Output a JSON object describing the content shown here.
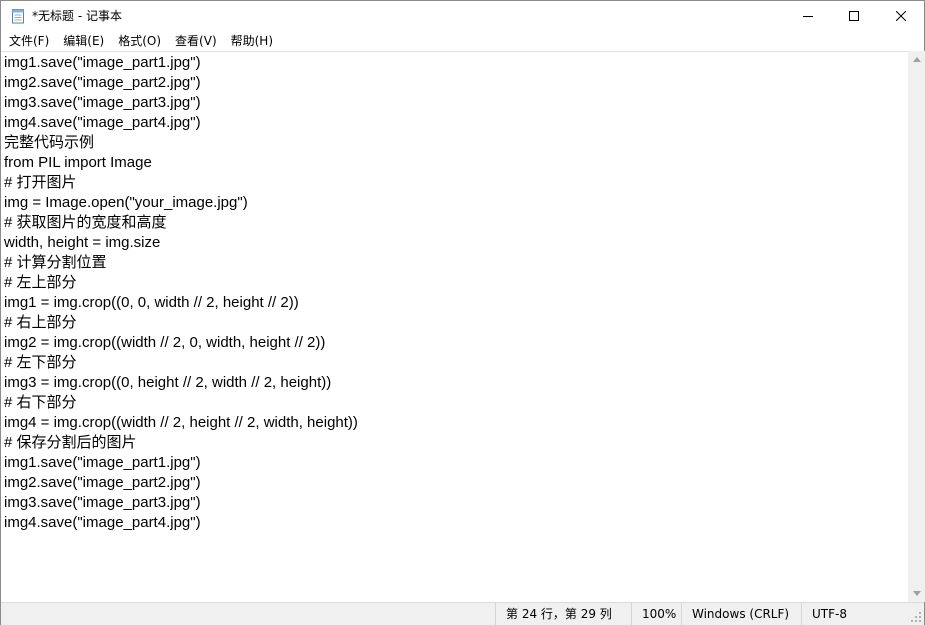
{
  "window": {
    "title": "*无标题 - 记事本",
    "app_icon": "notepad-icon",
    "controls": {
      "minimize_icon": "minimize-icon",
      "maximize_icon": "maximize-icon",
      "close_icon": "close-icon"
    }
  },
  "menu": {
    "items": [
      {
        "label": "文件(F)"
      },
      {
        "label": "编辑(E)"
      },
      {
        "label": "格式(O)"
      },
      {
        "label": "查看(V)"
      },
      {
        "label": "帮助(H)"
      }
    ]
  },
  "editor": {
    "lines": [
      "img1.save(\"image_part1.jpg\")",
      "img2.save(\"image_part2.jpg\")",
      "img3.save(\"image_part3.jpg\")",
      "img4.save(\"image_part4.jpg\")",
      "完整代码示例",
      "from PIL import Image",
      "# 打开图片",
      "img = Image.open(\"your_image.jpg\")",
      "# 获取图片的宽度和高度",
      "width, height = img.size",
      "# 计算分割位置",
      "# 左上部分",
      "img1 = img.crop((0, 0, width // 2, height // 2))",
      "# 右上部分",
      "img2 = img.crop((width // 2, 0, width, height // 2))",
      "# 左下部分",
      "img3 = img.crop((0, height // 2, width // 2, height))",
      "# 右下部分",
      "img4 = img.crop((width // 2, height // 2, width, height))",
      "# 保存分割后的图片",
      "img1.save(\"image_part1.jpg\")",
      "img2.save(\"image_part2.jpg\")",
      "img3.save(\"image_part3.jpg\")",
      "img4.save(\"image_part4.jpg\")"
    ]
  },
  "scrollbar": {
    "up_icon": "scroll-up-arrow-icon",
    "down_icon": "scroll-down-arrow-icon"
  },
  "statusbar": {
    "position": "第 24 行，第 29 列",
    "zoom": "100%",
    "line_ending": "Windows (CRLF)",
    "encoding": "UTF-8"
  }
}
